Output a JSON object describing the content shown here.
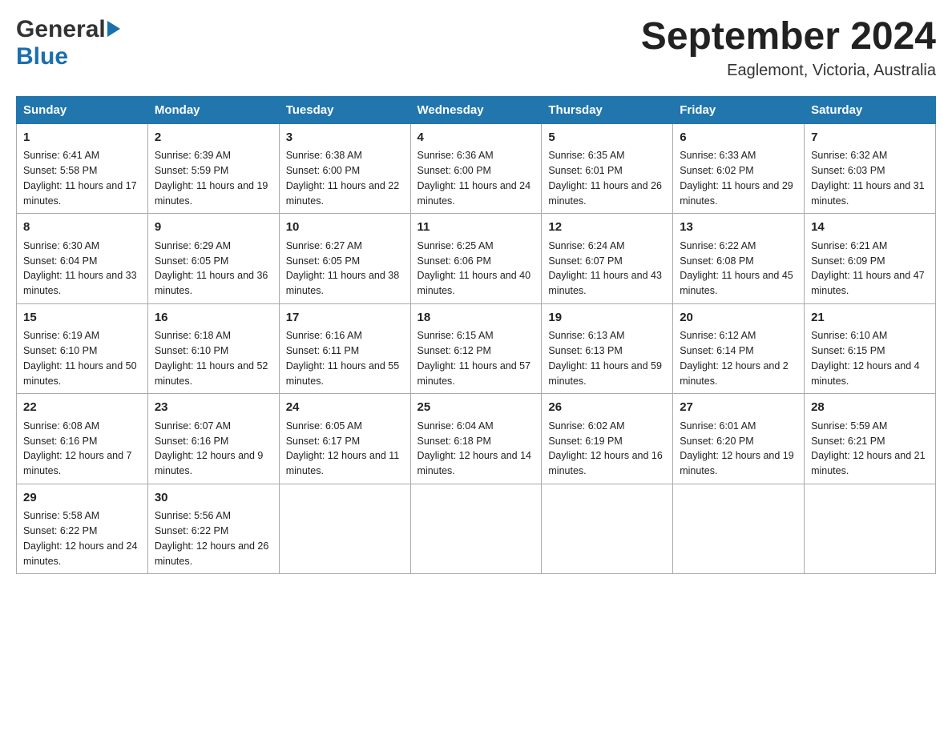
{
  "header": {
    "month_title": "September 2024",
    "location": "Eaglemont, Victoria, Australia",
    "logo_general": "General",
    "logo_blue": "Blue"
  },
  "weekdays": [
    "Sunday",
    "Monday",
    "Tuesday",
    "Wednesday",
    "Thursday",
    "Friday",
    "Saturday"
  ],
  "weeks": [
    [
      {
        "day": "1",
        "sunrise": "6:41 AM",
        "sunset": "5:58 PM",
        "daylight": "11 hours and 17 minutes."
      },
      {
        "day": "2",
        "sunrise": "6:39 AM",
        "sunset": "5:59 PM",
        "daylight": "11 hours and 19 minutes."
      },
      {
        "day": "3",
        "sunrise": "6:38 AM",
        "sunset": "6:00 PM",
        "daylight": "11 hours and 22 minutes."
      },
      {
        "day": "4",
        "sunrise": "6:36 AM",
        "sunset": "6:00 PM",
        "daylight": "11 hours and 24 minutes."
      },
      {
        "day": "5",
        "sunrise": "6:35 AM",
        "sunset": "6:01 PM",
        "daylight": "11 hours and 26 minutes."
      },
      {
        "day": "6",
        "sunrise": "6:33 AM",
        "sunset": "6:02 PM",
        "daylight": "11 hours and 29 minutes."
      },
      {
        "day": "7",
        "sunrise": "6:32 AM",
        "sunset": "6:03 PM",
        "daylight": "11 hours and 31 minutes."
      }
    ],
    [
      {
        "day": "8",
        "sunrise": "6:30 AM",
        "sunset": "6:04 PM",
        "daylight": "11 hours and 33 minutes."
      },
      {
        "day": "9",
        "sunrise": "6:29 AM",
        "sunset": "6:05 PM",
        "daylight": "11 hours and 36 minutes."
      },
      {
        "day": "10",
        "sunrise": "6:27 AM",
        "sunset": "6:05 PM",
        "daylight": "11 hours and 38 minutes."
      },
      {
        "day": "11",
        "sunrise": "6:25 AM",
        "sunset": "6:06 PM",
        "daylight": "11 hours and 40 minutes."
      },
      {
        "day": "12",
        "sunrise": "6:24 AM",
        "sunset": "6:07 PM",
        "daylight": "11 hours and 43 minutes."
      },
      {
        "day": "13",
        "sunrise": "6:22 AM",
        "sunset": "6:08 PM",
        "daylight": "11 hours and 45 minutes."
      },
      {
        "day": "14",
        "sunrise": "6:21 AM",
        "sunset": "6:09 PM",
        "daylight": "11 hours and 47 minutes."
      }
    ],
    [
      {
        "day": "15",
        "sunrise": "6:19 AM",
        "sunset": "6:10 PM",
        "daylight": "11 hours and 50 minutes."
      },
      {
        "day": "16",
        "sunrise": "6:18 AM",
        "sunset": "6:10 PM",
        "daylight": "11 hours and 52 minutes."
      },
      {
        "day": "17",
        "sunrise": "6:16 AM",
        "sunset": "6:11 PM",
        "daylight": "11 hours and 55 minutes."
      },
      {
        "day": "18",
        "sunrise": "6:15 AM",
        "sunset": "6:12 PM",
        "daylight": "11 hours and 57 minutes."
      },
      {
        "day": "19",
        "sunrise": "6:13 AM",
        "sunset": "6:13 PM",
        "daylight": "11 hours and 59 minutes."
      },
      {
        "day": "20",
        "sunrise": "6:12 AM",
        "sunset": "6:14 PM",
        "daylight": "12 hours and 2 minutes."
      },
      {
        "day": "21",
        "sunrise": "6:10 AM",
        "sunset": "6:15 PM",
        "daylight": "12 hours and 4 minutes."
      }
    ],
    [
      {
        "day": "22",
        "sunrise": "6:08 AM",
        "sunset": "6:16 PM",
        "daylight": "12 hours and 7 minutes."
      },
      {
        "day": "23",
        "sunrise": "6:07 AM",
        "sunset": "6:16 PM",
        "daylight": "12 hours and 9 minutes."
      },
      {
        "day": "24",
        "sunrise": "6:05 AM",
        "sunset": "6:17 PM",
        "daylight": "12 hours and 11 minutes."
      },
      {
        "day": "25",
        "sunrise": "6:04 AM",
        "sunset": "6:18 PM",
        "daylight": "12 hours and 14 minutes."
      },
      {
        "day": "26",
        "sunrise": "6:02 AM",
        "sunset": "6:19 PM",
        "daylight": "12 hours and 16 minutes."
      },
      {
        "day": "27",
        "sunrise": "6:01 AM",
        "sunset": "6:20 PM",
        "daylight": "12 hours and 19 minutes."
      },
      {
        "day": "28",
        "sunrise": "5:59 AM",
        "sunset": "6:21 PM",
        "daylight": "12 hours and 21 minutes."
      }
    ],
    [
      {
        "day": "29",
        "sunrise": "5:58 AM",
        "sunset": "6:22 PM",
        "daylight": "12 hours and 24 minutes."
      },
      {
        "day": "30",
        "sunrise": "5:56 AM",
        "sunset": "6:22 PM",
        "daylight": "12 hours and 26 minutes."
      },
      null,
      null,
      null,
      null,
      null
    ]
  ],
  "labels": {
    "sunrise": "Sunrise:",
    "sunset": "Sunset:",
    "daylight": "Daylight:"
  }
}
